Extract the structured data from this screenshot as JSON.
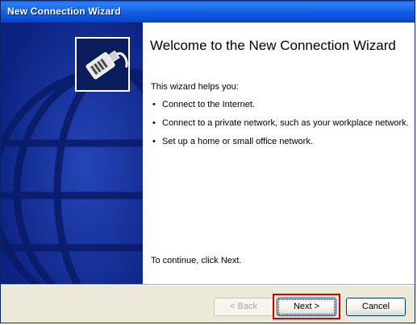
{
  "window": {
    "title": "New Connection Wizard"
  },
  "sidebar": {
    "icon": "network-cable-icon",
    "background_color": "#10298c"
  },
  "content": {
    "heading": "Welcome to the New Connection Wizard",
    "intro": "This wizard helps you:",
    "bullets": [
      "Connect to the Internet.",
      "Connect to a private network, such as your workplace network.",
      "Set up a home or small office network."
    ],
    "footer": "To continue, click Next."
  },
  "buttons": {
    "back_label": "< Back",
    "back_enabled": false,
    "next_label": "Next >",
    "cancel_label": "Cancel"
  },
  "colors": {
    "titlebar": "#0a4fd5",
    "highlight": "#d40000"
  }
}
